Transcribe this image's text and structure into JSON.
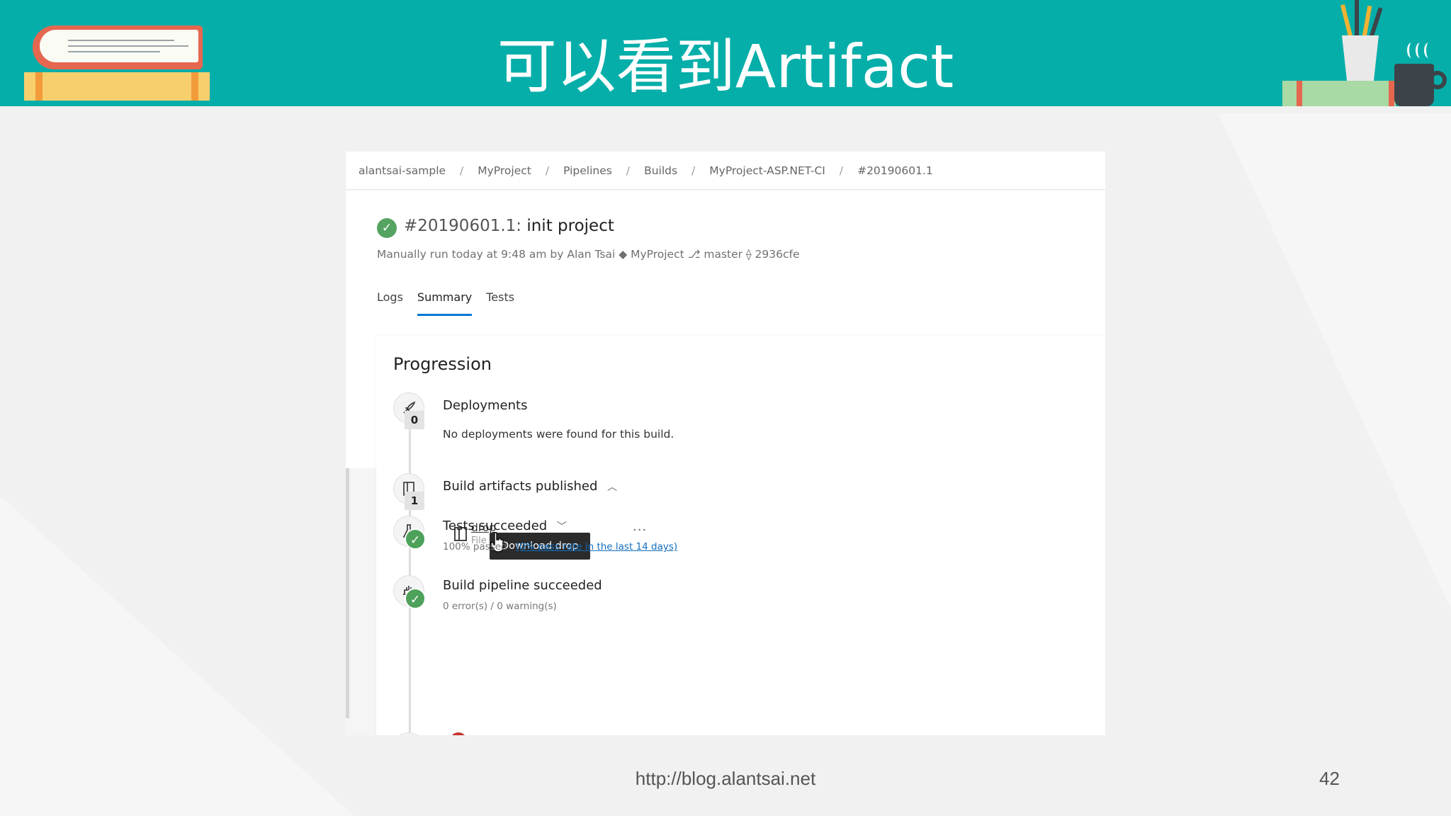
{
  "slide": {
    "title": "可以看到Artifact",
    "footer_url": "http://blog.alantsai.net",
    "page_number": "42",
    "colors": {
      "header": "#06aea9",
      "background": "#f1f1f1"
    }
  },
  "breadcrumb": [
    "alantsai-sample",
    "MyProject",
    "Pipelines",
    "Builds",
    "MyProject-ASP.NET-CI",
    "#20190601.1"
  ],
  "build": {
    "number": "#20190601.1:",
    "name": "init project",
    "meta": "Manually run today at 9:48 am by Alan Tsai ◆ MyProject ⎇ master ⟠ 2936cfe",
    "status_icon": "success-check-icon"
  },
  "tabs": [
    {
      "label": "Logs",
      "active": false
    },
    {
      "label": "Summary",
      "active": true
    },
    {
      "label": "Tests",
      "active": false
    }
  ],
  "progression": {
    "heading": "Progression",
    "deployments": {
      "title": "Deployments",
      "count": "0",
      "desc": "No deployments were found for this build.",
      "icon": "rocket-icon"
    },
    "artifacts": {
      "title": "Build artifacts published",
      "count": "1",
      "icon": "artifact-icon",
      "item_name": "drop",
      "item_type": "File",
      "more": "···",
      "tooltip": "Download drop"
    },
    "tests": {
      "title": "Tests succeeded",
      "passed": "100% passed",
      "link": "(0% pass rate in the last 14 days)",
      "icon": "flask-icon"
    },
    "pipeline": {
      "title": "Build pipeline succeeded",
      "summary": "0 error(s) / 0 warning(s)",
      "icon": "pipeline-icon"
    }
  }
}
